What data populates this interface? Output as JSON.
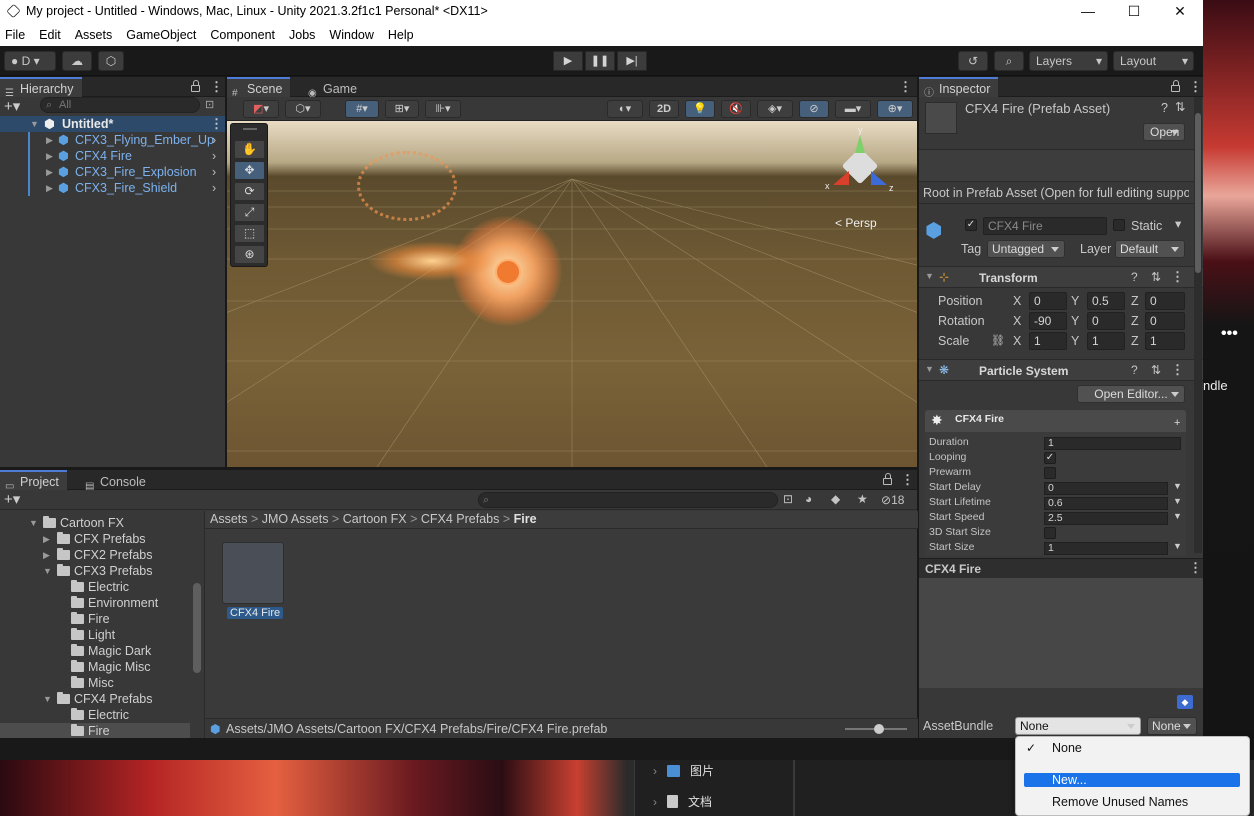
{
  "window": {
    "title": "My project - Untitled - Windows, Mac, Linux - Unity 2021.3.2f1c1 Personal* <DX11>",
    "minimize": "—",
    "maximize": "☐",
    "close": "✕"
  },
  "menu": [
    "File",
    "Edit",
    "Assets",
    "GameObject",
    "Component",
    "Jobs",
    "Window",
    "Help"
  ],
  "toolbar": {
    "account": "D",
    "layers_label": "Layers",
    "layout_label": "Layout"
  },
  "hierarchy": {
    "tab": "Hierarchy",
    "search_placeholder": "All",
    "scene_name": "Untitled*",
    "items": [
      "CFX3_Flying_Ember_Up",
      "CFX4 Fire",
      "CFX3_Fire_Explosion",
      "CFX3_Fire_Shield"
    ]
  },
  "scene": {
    "tab_scene": "Scene",
    "tab_game": "Game",
    "mode_2d": "2D",
    "persp": "Persp",
    "gizmo_x": "x",
    "gizmo_y": "y",
    "gizmo_z": "z"
  },
  "project": {
    "tab_project": "Project",
    "tab_console": "Console",
    "hidden_count": "18",
    "tree": [
      {
        "label": "Cartoon FX",
        "depth": 1,
        "open": true
      },
      {
        "label": "CFX Prefabs",
        "depth": 2,
        "open": false
      },
      {
        "label": "CFX2 Prefabs",
        "depth": 2,
        "open": false
      },
      {
        "label": "CFX3 Prefabs",
        "depth": 2,
        "open": true
      },
      {
        "label": "Electric",
        "depth": 3
      },
      {
        "label": "Environment",
        "depth": 3
      },
      {
        "label": "Fire",
        "depth": 3
      },
      {
        "label": "Light",
        "depth": 3
      },
      {
        "label": "Magic Dark",
        "depth": 3
      },
      {
        "label": "Magic Misc",
        "depth": 3
      },
      {
        "label": "Misc",
        "depth": 3
      },
      {
        "label": "CFX4 Prefabs",
        "depth": 2,
        "open": true
      },
      {
        "label": "Electric",
        "depth": 3
      },
      {
        "label": "Fire",
        "depth": 3,
        "selected": true
      }
    ],
    "breadcrumb": [
      "Assets",
      "JMO Assets",
      "Cartoon FX",
      "CFX4 Prefabs",
      "Fire"
    ],
    "asset_label": "CFX4 Fire",
    "path": "Assets/JMO Assets/Cartoon FX/CFX4 Prefabs/Fire/CFX4 Fire.prefab"
  },
  "inspector": {
    "tab": "Inspector",
    "asset_title": "CFX4 Fire (Prefab Asset)",
    "open_button": "Open",
    "root_note": "Root in Prefab Asset (Open for full editing support)",
    "object_name": "CFX4 Fire",
    "static_label": "Static",
    "tag_label": "Tag",
    "tag_value": "Untagged",
    "layer_label": "Layer",
    "layer_value": "Default",
    "transform": {
      "title": "Transform",
      "position_label": "Position",
      "position": {
        "x": "0",
        "y": "0.5",
        "z": "0"
      },
      "rotation_label": "Rotation",
      "rotation": {
        "x": "-90",
        "y": "0",
        "z": "0"
      },
      "scale_label": "Scale",
      "scale": {
        "x": "1",
        "y": "1",
        "z": "1"
      }
    },
    "particle": {
      "title": "Particle System",
      "open_editor": "Open Editor...",
      "system_name": "CFX4 Fire",
      "rows": [
        {
          "label": "Duration",
          "value": "1",
          "kind": "field"
        },
        {
          "label": "Looping",
          "value": "✓",
          "kind": "check"
        },
        {
          "label": "Prewarm",
          "value": "",
          "kind": "check"
        },
        {
          "label": "Start Delay",
          "value": "0",
          "kind": "drop"
        },
        {
          "label": "Start Lifetime",
          "value": "0.6",
          "kind": "drop"
        },
        {
          "label": "Start Speed",
          "value": "2.5",
          "kind": "drop"
        },
        {
          "label": "3D Start Size",
          "value": "",
          "kind": "check"
        },
        {
          "label": "Start Size",
          "value": "1",
          "kind": "drop"
        }
      ]
    },
    "preview_title": "CFX4 Fire",
    "assetbundle_label": "AssetBundle",
    "assetbundle_value": "None",
    "variant_value": "None"
  },
  "popup": {
    "items": [
      "None",
      "New...",
      "Remove Unused Names"
    ]
  },
  "explorer": {
    "items": [
      "图片",
      "文档"
    ]
  },
  "desktop_side_label": "ndle"
}
